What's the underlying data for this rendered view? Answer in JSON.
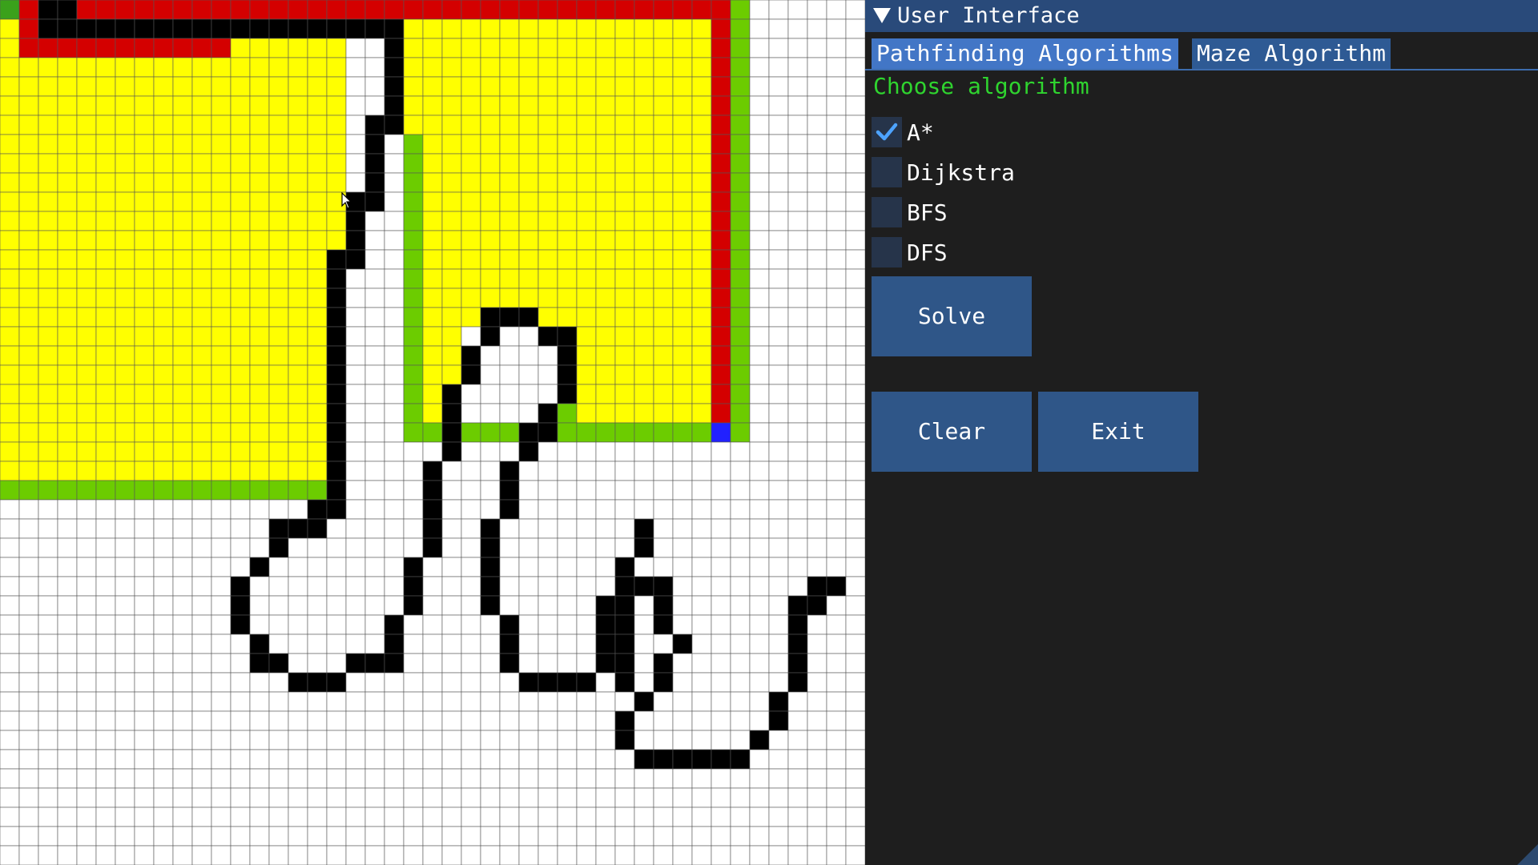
{
  "grid_view": {
    "cols": 45,
    "rows": 45,
    "colors": {
      "empty": "#ffffff",
      "wall": "#000000",
      "visited": "#ffff00",
      "frontier": "#6ccc00",
      "path": "#d40000",
      "target": "#2121ff",
      "start": "#3aa11b",
      "grid_line": "#555555"
    }
  },
  "panel": {
    "title": "User Interface",
    "collapse_icon": "triangle-down-icon",
    "tabs": [
      {
        "label": "Pathfinding Algorithms",
        "active": true
      },
      {
        "label": "Maze Algorithm",
        "active": false
      }
    ],
    "section_label": "Choose algorithm",
    "algorithms": [
      {
        "label": "A*",
        "checked": true
      },
      {
        "label": "Dijkstra",
        "checked": false
      },
      {
        "label": "BFS",
        "checked": false
      },
      {
        "label": "DFS",
        "checked": false
      }
    ],
    "buttons": {
      "solve": "Solve",
      "clear": "Clear",
      "exit": "Exit"
    },
    "colors": {
      "panel_bg": "#1e1e1e",
      "title_bg": "#294a7a",
      "tab_active": "#4276c6",
      "tab_inactive": "#2e5a94",
      "section_text": "#2fd42f",
      "checkbox_bg": "#26344a",
      "checkmark": "#4da3ff",
      "button_bg": "#2f5688"
    }
  }
}
